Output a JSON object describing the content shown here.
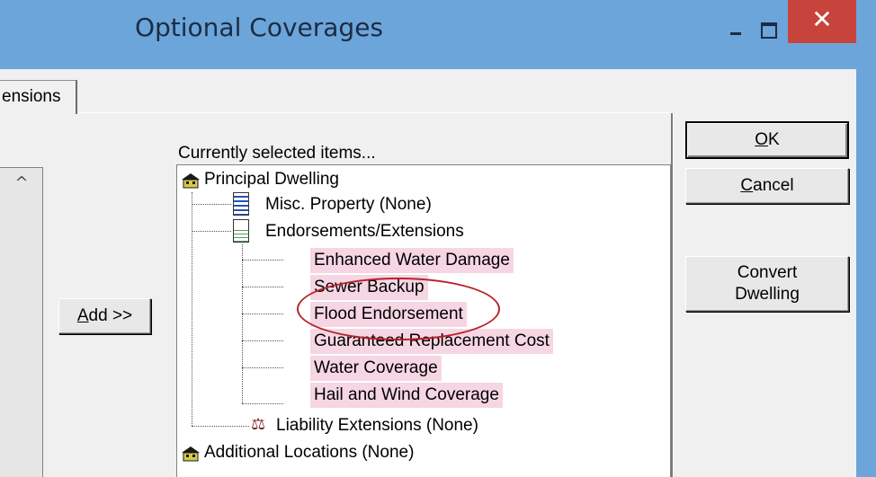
{
  "window": {
    "title": "Optional Coverages",
    "minimize_glyph": "",
    "maximize_glyph": "",
    "close_glyph": "✕"
  },
  "tab": {
    "label": "ensions"
  },
  "left_list": {
    "scroll_up_glyph": "^"
  },
  "buttons": {
    "add_prefix": "A",
    "add_rest": "dd >>",
    "ok_prefix": "O",
    "ok_rest": "K",
    "cancel_prefix": "C",
    "cancel_rest": "ancel",
    "convert_line1": "Convert",
    "convert_line2": "Dwelling"
  },
  "selected": {
    "label": "Currently selected items...",
    "tree": {
      "root": "Principal Dwelling",
      "misc": "Misc. Property (None)",
      "endorsements": "Endorsements/Extensions",
      "items": [
        "Enhanced Water Damage",
        "Sewer Backup",
        "Flood Endorsement",
        "Guaranteed Replacement Cost",
        "Water Coverage",
        "Hail and Wind Coverage"
      ],
      "liability": "Liability Extensions (None)",
      "additional": "Additional Locations (None)"
    },
    "highlight_color": "#f6d6e3",
    "annotation_color": "#b4232a"
  },
  "icons": {
    "root": "house-icon",
    "misc": "document-blue-icon",
    "endorsements": "document-green-icon",
    "liability": "scales-icon",
    "additional": "house-icon"
  }
}
